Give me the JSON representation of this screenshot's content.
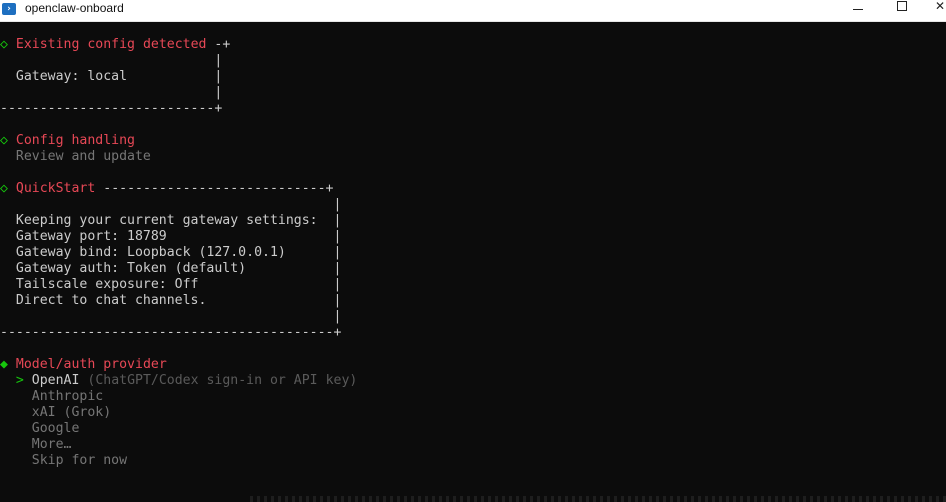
{
  "window": {
    "title": "openclaw-onboard"
  },
  "terminal": {
    "lines": [
      {
        "prefix": "◇",
        "text": "Existing config detected",
        "suffix": " -+"
      },
      {
        "text": "                           |"
      },
      {
        "text": "  Gateway: local           |"
      },
      {
        "text": "                           |"
      },
      {
        "text": "---------------------------+"
      },
      {
        "text": ""
      },
      {
        "prefix": "◇",
        "text": "Config handling"
      },
      {
        "text": "  Review and update"
      },
      {
        "text": ""
      },
      {
        "prefix": "◇",
        "text": "QuickStart",
        "suffix": " ----------------------------+"
      },
      {
        "text": "                                          |"
      },
      {
        "text": "  Keeping your current gateway settings:  |"
      },
      {
        "text": "  Gateway port: 18789                     |"
      },
      {
        "text": "  Gateway bind: Loopback (127.0.0.1)      |"
      },
      {
        "text": "  Gateway auth: Token (default)           |"
      },
      {
        "text": "  Tailscale exposure: Off                 |"
      },
      {
        "text": "  Direct to chat channels.                |"
      },
      {
        "text": "                                          |"
      },
      {
        "text": "------------------------------------------+"
      },
      {
        "text": ""
      },
      {
        "prefix": "◆",
        "text": "Model/auth provider"
      },
      {
        "pointer": ">",
        "text": "OpenAI",
        "hint": " (ChatGPT/Codex sign-in or API key)"
      },
      {
        "text": "    Anthropic"
      },
      {
        "text": "    xAI (Grok)"
      },
      {
        "text": "    Google"
      },
      {
        "text": "    More…"
      },
      {
        "text": "    Skip for now"
      }
    ]
  },
  "colors": {
    "background": "#0c0c0c",
    "text": "#cccccc",
    "heading": "#e74856",
    "marker": "#16c60c",
    "muted": "#767676"
  },
  "icons": {
    "app": "powershell-icon",
    "minimize": "minimize-icon",
    "maximize": "maximize-icon",
    "close": "close-icon"
  }
}
